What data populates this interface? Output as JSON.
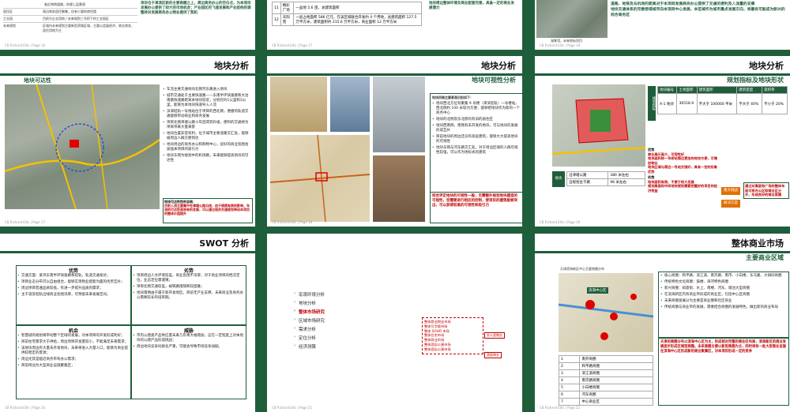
{
  "top": {
    "s1": {
      "rows": [
        {
          "label": "",
          "text": "临近南侧道路，仰望上层景观"
        },
        {
          "label": "居住区",
          "text": "周边商务居住聚集，仅有少量的商住楼"
        },
        {
          "label": "工业园",
          "text": "目前为企业用地 / 未来规划三号桥下的工业园区"
        },
        {
          "label": "未来规划",
          "text": "区域内未来规划主要新型滨城区域，主要以会展经济、商业商务、居住用地为主"
        }
      ],
      "footer": "CB Richard Ellis | Page 16"
    },
    "s2": {
      "row11": [
        "11",
        "精彩广场",
        "一品地 5.6 亩，总建筑面积"
      ],
      "row12": [
        "12",
        "天阳苑",
        "一层占地面积 586 亿元，在该区域联合开发约 4 个用地，总建筑面积 127.5 万平方米，建筑面积约 215.6 万平方米，商业面积 12 万平方米"
      ],
      "note": "地块周边整体环境及商业配套完善，具备一定的商业发展潜力",
      "footer": "CB Richard Ellis | Page 17"
    },
    "s3": {
      "caption": "湖景湾，未来地标项目",
      "notes": [
        "道路、地铁及与机场的距离对于本项目发展商务办公提供了交通的便利及人流量的支撑",
        "地块交通体系的完善使得城市向本项目中心发展，本区域作为城市重点发展方向，将最有可能成为新兴的综合商务区"
      ],
      "footer": "CB Richard Ellis | Page 18"
    },
    "s1_side": "项目位于津滨区新的主要商圈之上，周边商务办公的空白点，为本项目发展办公提供了较大的市场机会；产业园区的飞速发展和产业结构的调整将对发展商务办公物业提供了契机"
  },
  "mid": {
    "s1": {
      "title": "地块分析",
      "subtitle": "地块可达性",
      "bullets": [
        "车流主要交通地块北侧河东路进入地块",
        "城市交通处于主要快速路——东南半环快速路和大沽南路快速路距离本地块较近，分别仅约1公里和3公里，能够为本地块快速导入人流",
        "滨海轻轨一号线站位于项目的西北侧，便捷的轨道交通能够带动商业和商务发展",
        "项目北侧津塘公路十年后得到升级，便利的交通将为项目带来大量来客",
        "地块位置非常有利，位于城市主要道路交汇处，能够被周边人群方便到达",
        "地块周边的商务办公和购物中心，良好的商业氛围会加强本项目的吸引力",
        "地块东侧为规划中的机场路，未来能够提高地块的可达性"
      ],
      "summary_title": "地块可达性性的总结：",
      "summary": "目前人流主要集中在津塘公路沿线，由于规模有限的影响，车流的可达性高将来的发展，可以通过相关交通规划带动本项目的整体价值提升",
      "footer": "CB Richard Ellis | Page 17"
    },
    "s2": {
      "title": "地块分析",
      "subtitle": "地块可视性分析",
      "box_title": "地块四周主要景观识别如下：",
      "bullets": [
        "地块西北方位有聚集 9 号楼（津滨轻轨）一号楼站，西北侧约 100 米较为方便，能够把地块作为新的一个商务中心",
        "地块的北侧及东北侧均有旧的居住区",
        "地块西南侧，南侧有未开发的地块，可与地块的发展形成互补",
        "目前地块的周边还没有高层建筑，能够大大提高地块的可视性",
        "地块东侧与河东路交汇处，对于周边区域的人群可视性较强，可以作为地标式的建筑"
      ],
      "conclusion": "综合评定地块的可视性一般，无需额外规划地块建造的可视性，但需要进行相应的控制，使项目的建筑能够突出，可以获得较高的可视性和吸引力",
      "footer": "CB Richard Ellis | Page 18"
    },
    "s3": {
      "title": "地块分析",
      "subtitle": "规划指标及地块形状",
      "table_header": [
        "地块编号",
        "土地面积",
        "建筑面积",
        "建筑密度",
        "容积率"
      ],
      "table_row": [
        "A-1 地块",
        "36518.9",
        "不大于 100000 平米",
        "不大于 40%",
        "不小于 20%"
      ],
      "side_label": "规划指标",
      "road_rows": [
        [
          "沿津塘公路",
          "380 米左右"
        ],
        [
          "沿规划主干路",
          "96 米左右"
        ]
      ],
      "road_label": "地块",
      "pros_title": "优势",
      "pros": [
        "商业展示面大，可视性好",
        "地块面积较一号桥站周边更加的地块方便，可增加物业",
        "地块区域与周边一号站交接好，具有一定的形象优势"
      ],
      "cons_title": "劣势",
      "cons": [
        "地块面积有限，不便于较大发展",
        "规划高层和中间地块规划需要把握好的项目的经济效益"
      ],
      "tags": [
        "重大挑战",
        "解决方案"
      ],
      "advice": "通过对高层和广场的整体布局可将办公区和商业区分开，形成良好的商业氛围",
      "footer": "CB Richard Ellis | Page 19"
    }
  },
  "bot": {
    "s1": {
      "title": "SWOT 分析",
      "strength_title": "优势",
      "strength": [
        "交通方面：紧邻东南半环快速路和轻轨，轨道交通发达；",
        "项目业态分布可以自由组合，能够实现物业配套为面的优势互补；",
        "周边项目普遍品质较低，有进一步提升品质的需求；",
        "主干道及轻轨沿线商业氛围浓厚，可预留未来发展空间。"
      ],
      "weakness_title": "劣势",
      "weakness": [
        "项目周边人文环境较差，商业氛围不浓厚，对于商业项目的档次定位，业态定位需谨慎；",
        "项目北侧交通较差，被铁路阻隔和较困难；",
        "地块南侧由于属于新开发地区，目前无产业支撑，未来商业及商务办公需要较长的培育期。"
      ],
      "opportunity_title": "机会",
      "opportunity": [
        "智慧城的规划将带动整个区域的发展，对本项目的开发形成利好；",
        "目前住宅需求大于供给，周边项目开发量较小，不能满足未来需求；",
        "该地块周边有大量未开发地块，未来将进入大量人口，能够为商业提供较稳定的客源；",
        "周边尤其是临近商务带有办公需求；",
        "目前周边为大型商业设施聚集区；"
      ],
      "threat_title": "威胁",
      "threat": [
        "市内公建类产品供应量未来几年将大幅增加，这在一定程度上对本地块的公建产品形成挑战；",
        "周边地块竞争同质化严重，可能会导致市场竞争加剧。"
      ],
      "footer": "CB Richard Ellis | Page 20"
    },
    "s2": {
      "menu": [
        "宏观环境分析",
        "地块分析",
        "整体市场研究",
        "区域市场研究",
        "需求分析",
        "定位分析",
        "经济测算"
      ],
      "active_index": 2,
      "sub_items": [
        "整体商业物业市场",
        "整体写字楼市场",
        "整体 SOHO 市场",
        "整体住宅市场",
        "整体商业市场",
        "整体酒店公寓市场",
        "整体酒店公寓市场"
      ],
      "tags": [
        "办公类物业",
        "酒类物业"
      ],
      "footer": "CB Richard Ellis | Page 21"
    },
    "s3": {
      "title": "整体商业市场",
      "subtitle": "主要商业区域",
      "map_caption": "天津滨海新区中心主要商圈分布",
      "map_label": "滨海中心区",
      "bullets": [
        "核心商圈：和平路、滨江道、南京路、南市、小白楼、东马路、大胡同商圈",
        "传统特色文化商圈：鼓楼、海河特色商圈",
        "新兴商圈：如意街、水上、南楼、河东、塘沽大型商圈",
        "在滨海新区内有商业带形成的商业区，包括中心区商圈",
        "未来商圈发展分为主要是商业圈和社区商业",
        "传统商圈与商业带的发展，需要结合商圈的发展特色，做出新的商业布局"
      ],
      "note": "天津的商圈分布以滨海中心区为主，形成相对完整的商业区布局，滨海新区的商业发展逐步形成区域型商圈。未来商圈主要以新型商圈为主，同时将有一批大型商业设施在滨海中心区形成新的商业聚集区，对本项目形成一定的竞争",
      "table_rows": [
        [
          "1",
          "南开商圈"
        ],
        [
          "2",
          "和平路商圈"
        ],
        [
          "3",
          "滨江道商圈"
        ],
        [
          "4",
          "南京路商圈"
        ],
        [
          "5",
          "小白楼商圈"
        ],
        [
          "6",
          "河东商圈"
        ],
        [
          "7",
          "中心商业区"
        ]
      ],
      "footer": "CB Richard Ellis | Page 22"
    }
  }
}
